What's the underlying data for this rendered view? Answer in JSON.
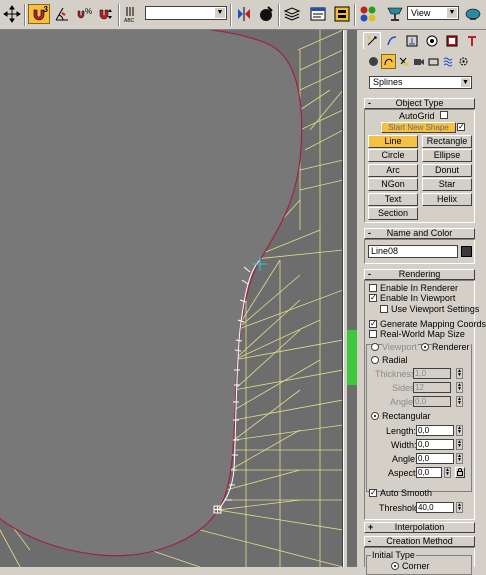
{
  "toolbar": {
    "icons": [
      "select-move-icon",
      "snap-3d-icon",
      "angle-snap-icon",
      "percent-snap-icon",
      "spinner-snap-icon",
      "edit-named-selection-icon",
      "mirror-icon",
      "align-icon",
      "layer-manager-icon",
      "curve-editor-icon",
      "schematic-view-icon",
      "material-editor-icon",
      "render-scene-icon",
      "quick-render-icon"
    ],
    "snap_label": "3",
    "abc_label": "ABC",
    "named_selection_value": "",
    "view_dropdown": "View"
  },
  "viewport": {
    "background": "#6d6d6d",
    "shape_fill": "#787878",
    "shape_stroke": "#a0204a",
    "wire_color": "#e0e08a"
  },
  "panel": {
    "tabs": [
      "create-tab",
      "modify-tab",
      "hierarchy-tab",
      "motion-tab",
      "display-tab",
      "utilities-tab"
    ],
    "sub_icons": [
      "geometry-icon",
      "shapes-icon",
      "lights-icon",
      "cameras-icon",
      "helpers-icon",
      "space-warps-icon",
      "systems-icon"
    ],
    "category": "Splines",
    "object_type": {
      "title": "Object Type",
      "autogrid": "AutoGrid",
      "start_new_shape": "Start New Shape",
      "buttons": [
        "Line",
        "Rectangle",
        "Circle",
        "Ellipse",
        "Arc",
        "Donut",
        "NGon",
        "Star",
        "Text",
        "Helix",
        "Section"
      ]
    },
    "name_and_color": {
      "title": "Name and Color",
      "name_value": "Line08",
      "color": "#3a3a3a"
    },
    "rendering": {
      "title": "Rendering",
      "enable_in_renderer": "Enable In Renderer",
      "enable_in_viewport": "Enable In Viewport",
      "use_viewport_settings": "Use Viewport Settings",
      "generate_mapping": "Generate Mapping Coords.",
      "real_world_map": "Real-World Map Size",
      "viewport_radio": "Viewport",
      "renderer_radio": "Renderer",
      "radial": "Radial",
      "thickness_label": "Thickness:",
      "thickness_value": "1,0",
      "sides_label": "Sides:",
      "sides_value": "12",
      "angle_label": "Angle:",
      "angle_value": "0,0",
      "rectangular": "Rectangular",
      "length_label": "Length:",
      "length_value": "0,0",
      "width_label": "Width:",
      "width_value": "0,0",
      "angle2_label": "Angle:",
      "angle2_value": "0,0",
      "aspect_label": "Aspect:",
      "aspect_value": "0,0",
      "auto_smooth": "Auto Smooth",
      "threshold_label": "Threshold:",
      "threshold_value": "40,0"
    },
    "interpolation": {
      "title": "Interpolation"
    },
    "creation_method": {
      "title": "Creation Method",
      "initial_type": "Initial Type",
      "corner": "Corner"
    }
  }
}
